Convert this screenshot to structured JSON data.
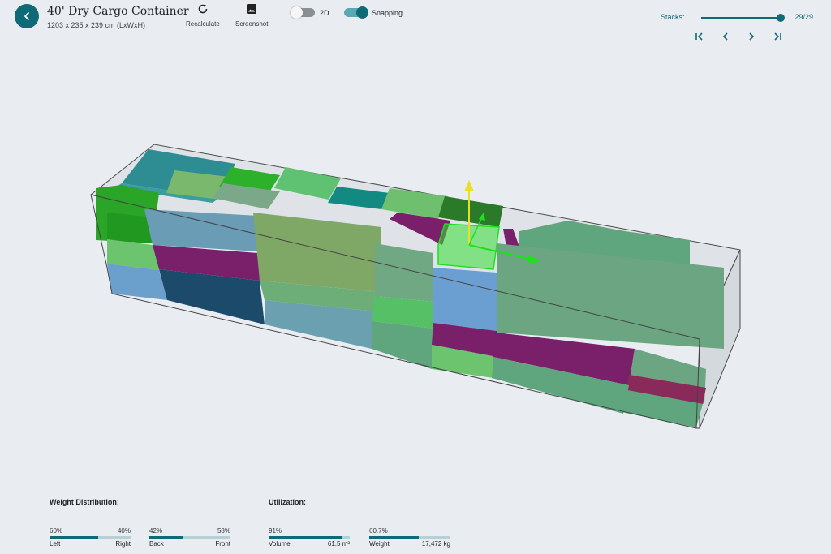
{
  "header": {
    "title": "40' Dry Cargo Container",
    "subtitle": "1203 x 235 x 239 cm (LxWxH)"
  },
  "toolbar": {
    "recalculate_label": "Recalculate",
    "screenshot_label": "Screenshot",
    "toggle_2d_label": "2D",
    "toggle_2d_on": false,
    "snapping_label": "Snapping",
    "snapping_on": true
  },
  "stacks": {
    "label": "Stacks:",
    "value_text": "29/29",
    "current": 29,
    "total": 29
  },
  "colors": {
    "accent": "#0f6a78",
    "purple": "#7a1f6a",
    "navy": "#1c4a6a",
    "sky": "#6b9fcc",
    "green": "#28a02a",
    "sage": "#5fa57e",
    "gizmo_y": "#e8e020",
    "gizmo_x": "#1fe01f"
  },
  "weight_distribution": {
    "title": "Weight Distribution:",
    "left_right": {
      "pct_left": "60%",
      "pct_right": "40%",
      "label_left": "Left",
      "label_right": "Right",
      "value": 0.6
    },
    "back_front": {
      "pct_left": "42%",
      "pct_right": "58%",
      "label_left": "Back",
      "label_right": "Front",
      "value": 0.42
    }
  },
  "utilization": {
    "title": "Utilization:",
    "volume": {
      "pct": "91%",
      "label": "Volume",
      "amount": "61.5 m³",
      "value": 0.91
    },
    "weight": {
      "pct": "60.7%",
      "label": "Weight",
      "amount": "17,472 kg",
      "value": 0.607
    }
  }
}
